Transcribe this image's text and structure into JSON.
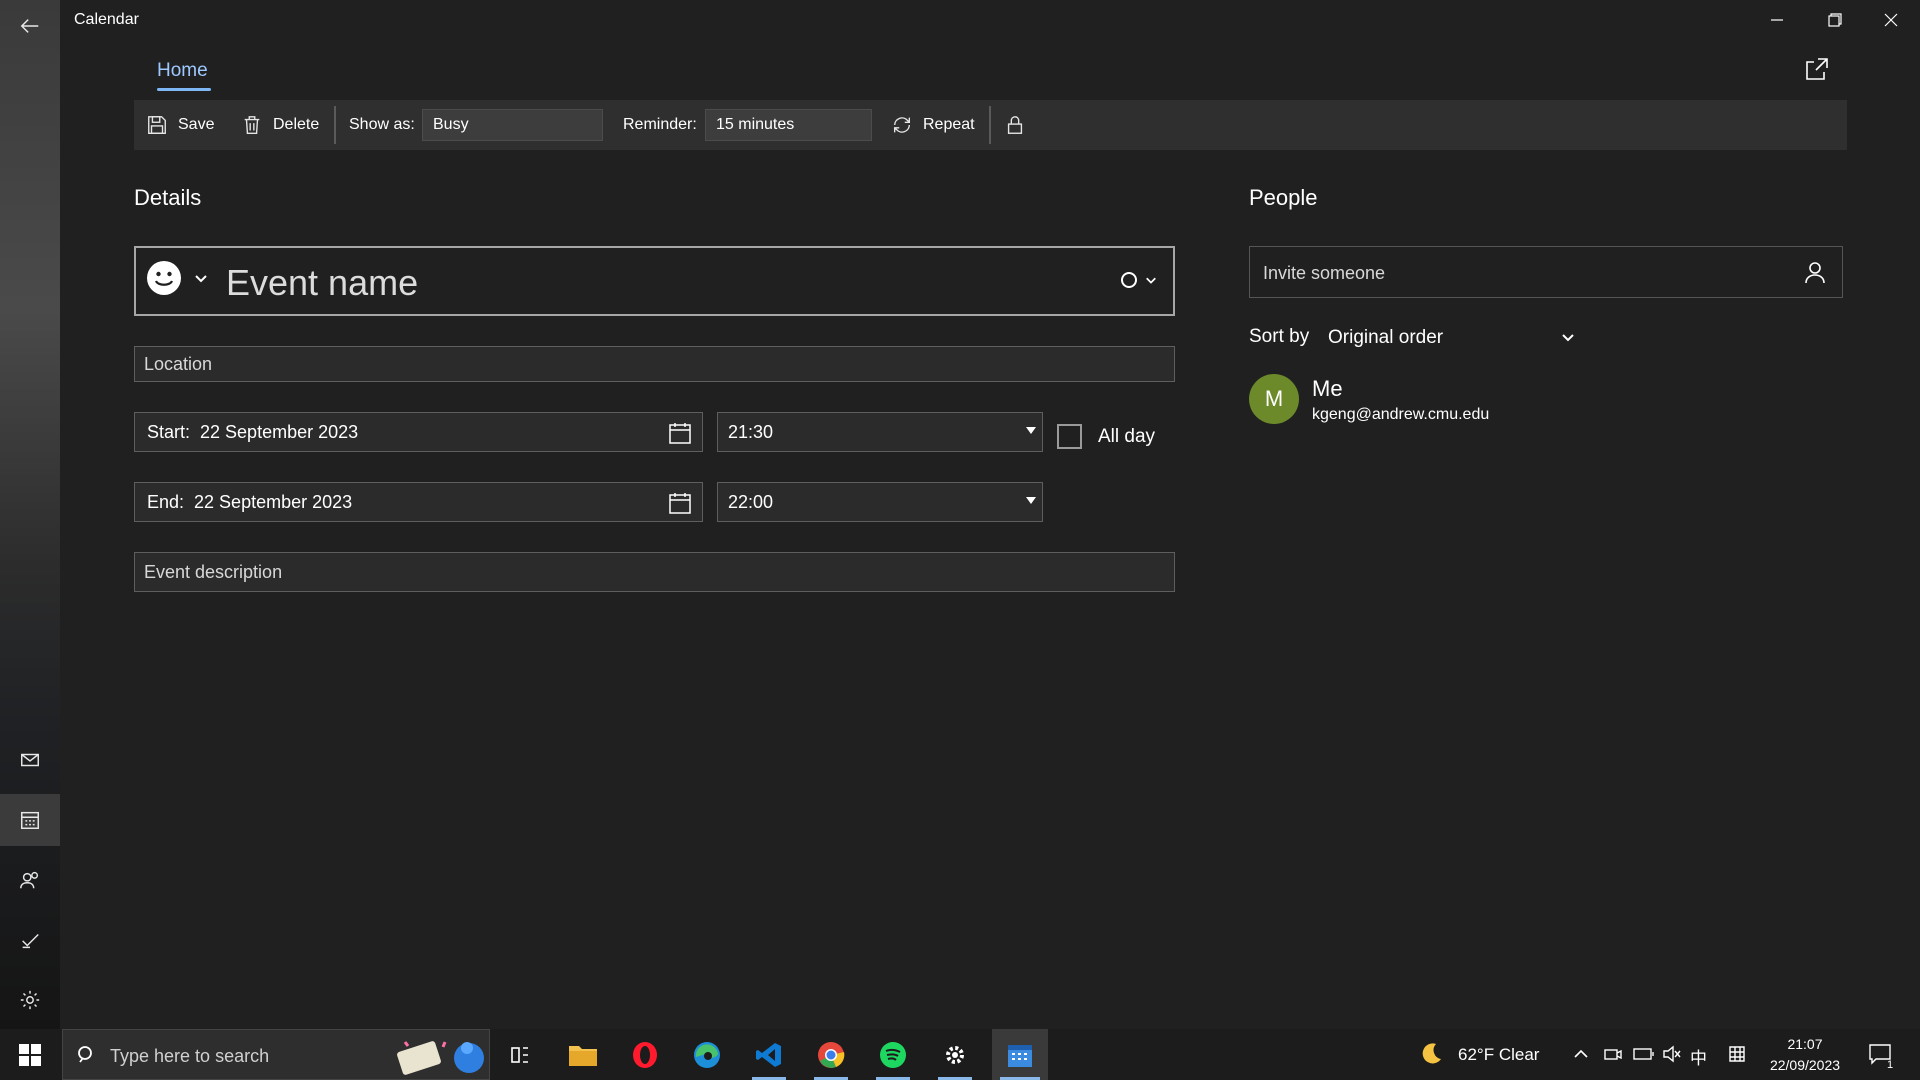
{
  "window": {
    "title": "Calendar"
  },
  "tabs": [
    {
      "label": "Home",
      "active": true
    }
  ],
  "toolbar": {
    "save_label": "Save",
    "delete_label": "Delete",
    "show_as_label": "Show as:",
    "show_as_value": "Busy",
    "reminder_label": "Reminder:",
    "reminder_value": "15 minutes",
    "repeat_label": "Repeat"
  },
  "details": {
    "heading": "Details",
    "event_name_placeholder": "Event name",
    "location_placeholder": "Location",
    "start_label": "Start:",
    "start_date": "22 September 2023",
    "start_time": "21:30",
    "end_label": "End:",
    "end_date": "22 September 2023",
    "end_time": "22:00",
    "all_day_label": "All day",
    "all_day_checked": false,
    "description_placeholder": "Event description"
  },
  "people": {
    "heading": "People",
    "invite_placeholder": "Invite someone",
    "sort_label": "Sort by",
    "sort_value": "Original order",
    "attendees": [
      {
        "initial": "M",
        "name": "Me",
        "email": "kgeng@andrew.cmu.edu",
        "avatar_color": "#6c8a2a"
      }
    ]
  },
  "taskbar": {
    "search_placeholder": "Type here to search",
    "weather": "62°F  Clear",
    "time": "21:07",
    "date": "22/09/2023",
    "notification_count": "1",
    "ime": "中"
  },
  "colors": {
    "accent": "#7fb6f5",
    "background": "#202020",
    "toolbar": "#2f2f2f"
  }
}
